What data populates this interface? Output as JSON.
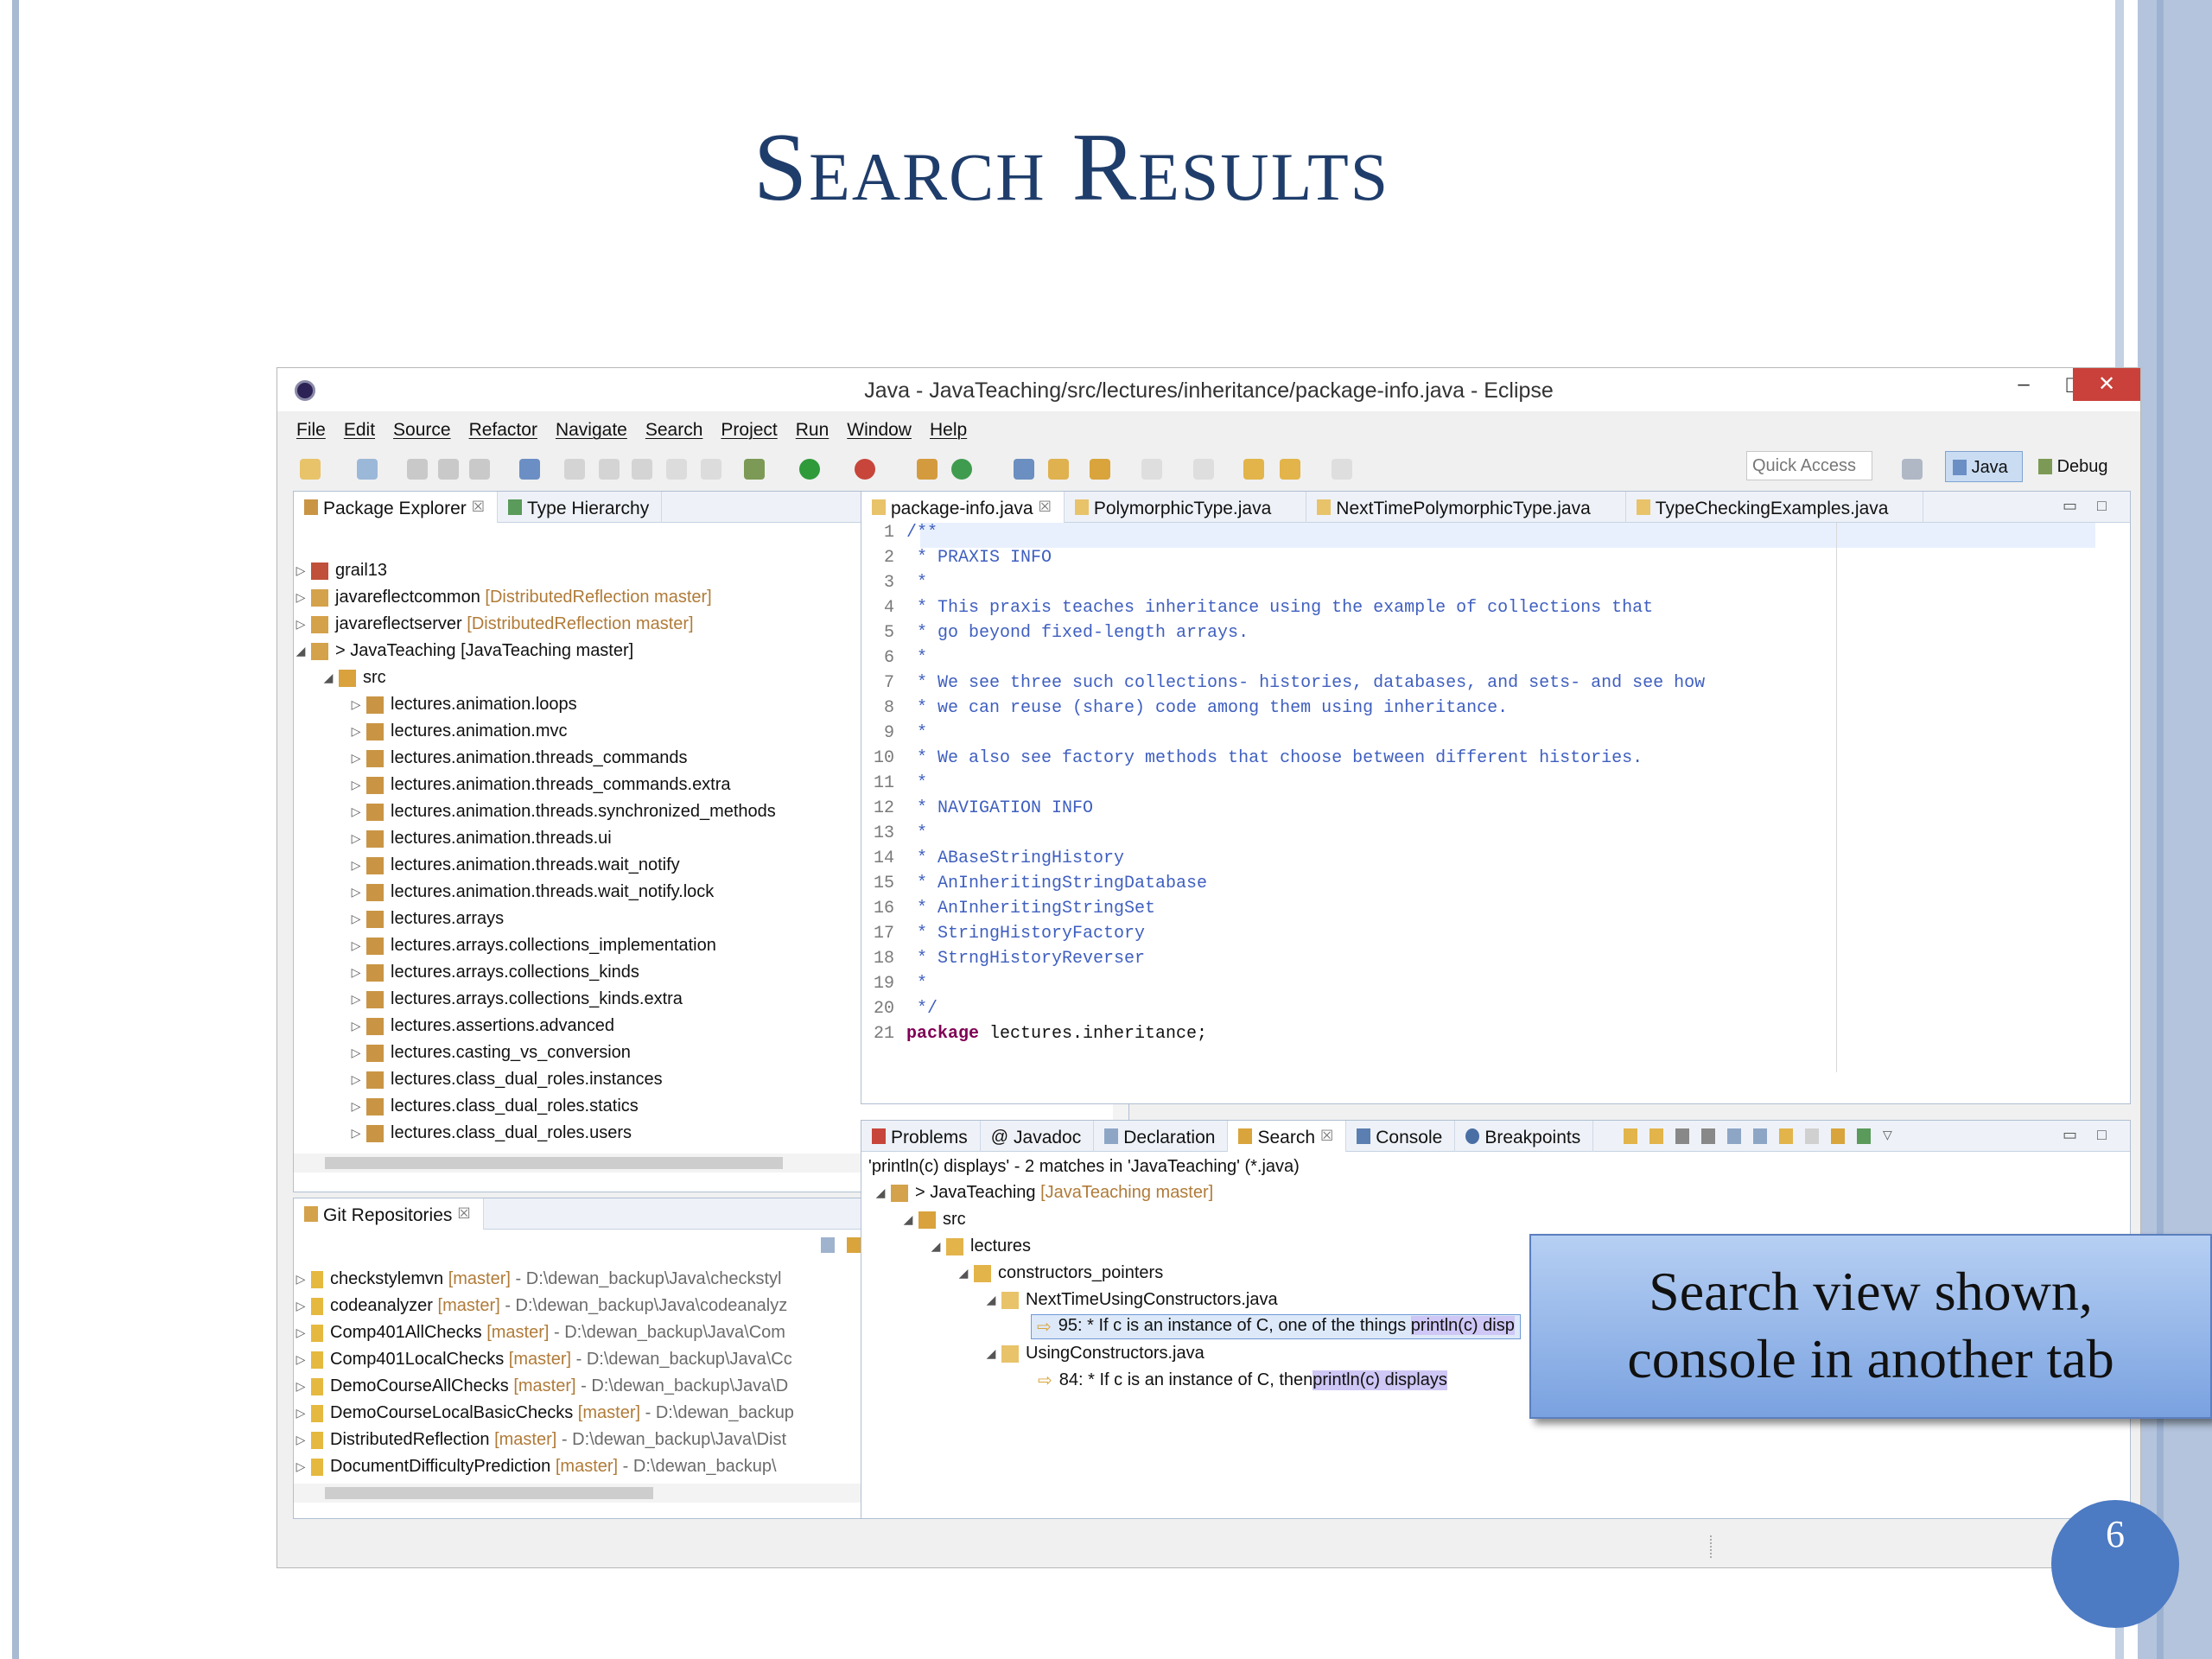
{
  "slide_title": "Search Results",
  "window": {
    "title": "Java - JavaTeaching/src/lectures/inheritance/package-info.java - Eclipse",
    "minimize": "–",
    "maximize": "□",
    "close": "✕"
  },
  "menu": [
    "File",
    "Edit",
    "Source",
    "Refactor",
    "Navigate",
    "Search",
    "Project",
    "Run",
    "Window",
    "Help"
  ],
  "quick_access": "Quick Access",
  "perspectives": {
    "java": "Java",
    "debug": "Debug"
  },
  "package_explorer": {
    "tabs": [
      "Package Explorer",
      "Type Hierarchy"
    ],
    "projects": [
      {
        "name": "grail13",
        "decoration": ""
      },
      {
        "name": "javareflectcommon",
        "decoration": "[DistributedReflection master]"
      },
      {
        "name": "javareflectserver",
        "decoration": "[DistributedReflection master]"
      },
      {
        "name": "> JavaTeaching",
        "decoration": "[JavaTeaching master]"
      }
    ],
    "src": "src",
    "packages": [
      "lectures.animation.loops",
      "lectures.animation.mvc",
      "lectures.animation.threads_commands",
      "lectures.animation.threads_commands.extra",
      "lectures.animation.threads.synchronized_methods",
      "lectures.animation.threads.ui",
      "lectures.animation.threads.wait_notify",
      "lectures.animation.threads.wait_notify.lock",
      "lectures.arrays",
      "lectures.arrays.collections_implementation",
      "lectures.arrays.collections_kinds",
      "lectures.arrays.collections_kinds.extra",
      "lectures.assertions.advanced",
      "lectures.casting_vs_conversion",
      "lectures.class_dual_roles.instances",
      "lectures.class_dual_roles.statics",
      "lectures.class_dual_roles.users"
    ]
  },
  "git": {
    "tab": "Git Repositories",
    "repos": [
      {
        "name": "checkstylemvn",
        "branch": "[master]",
        "path": "- D:\\dewan_backup\\Java\\checkstyl"
      },
      {
        "name": "codeanalyzer",
        "branch": "[master]",
        "path": "- D:\\dewan_backup\\Java\\codeanalyz"
      },
      {
        "name": "Comp401AllChecks",
        "branch": "[master]",
        "path": "- D:\\dewan_backup\\Java\\Com"
      },
      {
        "name": "Comp401LocalChecks",
        "branch": "[master]",
        "path": "- D:\\dewan_backup\\Java\\Cc"
      },
      {
        "name": "DemoCourseAllChecks",
        "branch": "[master]",
        "path": "- D:\\dewan_backup\\Java\\D"
      },
      {
        "name": "DemoCourseLocalBasicChecks",
        "branch": "[master]",
        "path": "- D:\\dewan_backup"
      },
      {
        "name": "DistributedReflection",
        "branch": "[master]",
        "path": "- D:\\dewan_backup\\Java\\Dist"
      },
      {
        "name": "DocumentDifficultyPrediction",
        "branch": "[master]",
        "path": "- D:\\dewan_backup\\"
      }
    ]
  },
  "editor": {
    "tabs": [
      "package-info.java",
      "PolymorphicType.java",
      "NextTimePolymorphicType.java",
      "TypeCheckingExamples.java"
    ],
    "lines": [
      "/**",
      " * PRAXIS INFO",
      " *",
      " * This praxis teaches inheritance using the example of collections that",
      " * go beyond fixed-length arrays.",
      " *",
      " * We see three such collections- histories, databases, and sets- and see how",
      " * we can reuse (share) code among them using inheritance.",
      " *",
      " * We also see factory methods that choose between different histories.",
      " *",
      " * NAVIGATION INFO",
      " *",
      " * ABaseStringHistory",
      " * AnInheritingStringDatabase",
      " * AnInheritingStringSet",
      " * StringHistoryFactory",
      " * StrngHistoryReverser",
      " *",
      " */"
    ],
    "package_keyword": "package",
    "package_rest": " lectures.inheritance;"
  },
  "bottom": {
    "tabs": [
      "Problems",
      "Javadoc",
      "Declaration",
      "Search",
      "Console",
      "Breakpoints"
    ],
    "summary": "'println(c) displays' - 2 matches in 'JavaTeaching' (*.java)",
    "project": "> JavaTeaching",
    "project_decoration": "[JavaTeaching master]",
    "src": "src",
    "lectures": "lectures",
    "package": "constructors_pointers",
    "file1": "NextTimeUsingConstructors.java",
    "match1_prefix": "95: * If c is an instance of C, one of the things ",
    "match1_hl": "println(c) disp",
    "file2": "UsingConstructors.java",
    "match2_prefix": "84: * If c is an instance of C, then ",
    "match2_hl": "println(c) displays"
  },
  "callout": {
    "line1": "Search view shown,",
    "line2": "console in another tab"
  },
  "page_number": "6"
}
